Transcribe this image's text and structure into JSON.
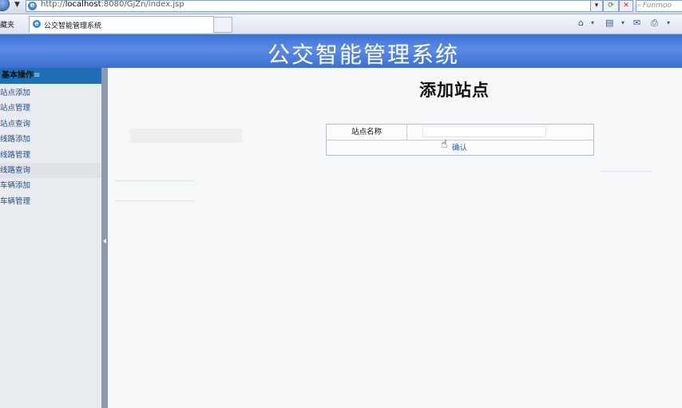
{
  "browser": {
    "address_url_prefix": "http://",
    "address_url_host": "localhost",
    "address_url_rest": ":8080/GjZn/index.jsp",
    "search_placeholder": "Funmoo",
    "favorites_label": "藏夹",
    "tab_title": "公交智能管理系统"
  },
  "header": {
    "title": "公交智能管理系统"
  },
  "sidebar": {
    "heading": "基本操作",
    "heading_marker": "≡",
    "items": [
      {
        "label": "站点添加"
      },
      {
        "label": "站点管理"
      },
      {
        "label": "站点查询"
      },
      {
        "label": "线路添加"
      },
      {
        "label": "线路管理"
      },
      {
        "label": "线路查询"
      },
      {
        "label": "车辆添加"
      },
      {
        "label": "车辆管理"
      }
    ]
  },
  "main": {
    "page_title": "添加站点",
    "form": {
      "station_name_label": "站点名称",
      "station_name_value": "",
      "confirm_label": "确认"
    }
  },
  "colors": {
    "banner": "#3b73d8",
    "sidebar_head": "#1e6fb5",
    "link": "#2a4d86",
    "splitter": "#8d9aac"
  }
}
